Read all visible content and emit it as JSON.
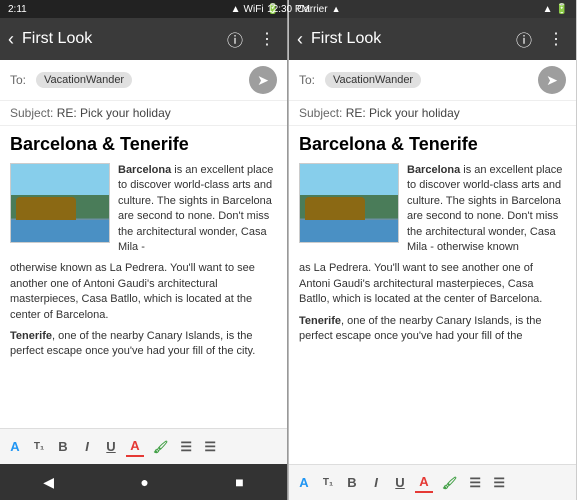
{
  "left_panel": {
    "status_bar": {
      "time": "2:11",
      "icons": "signal wifi battery"
    },
    "app_bar": {
      "title": "First Look",
      "info_icon": "ⓘ",
      "more_icon": "⋮"
    },
    "email": {
      "to_label": "To:",
      "recipient": "VacationWander",
      "subject_label": "Subject:",
      "subject": "RE: Pick your holiday",
      "headline": "Barcelona & Tenerife",
      "body_bold1": "Barcelona",
      "body_text1": " is an excellent place to discover world-class arts and culture. The sights in Barcelona are second to none. Don't miss the architectural wonder, Casa Mila - otherwise known as La Pedrera. You'll want to see another one of Antoni Gaudi's architectural masterpieces, Casa Batllo, which is located at the center of Barcelona.",
      "body_bold2": "Tenerife",
      "body_text2": ", one of the nearby Canary Islands, is the perfect escape once you've had your fill of the city."
    },
    "toolbar": {
      "a_label": "A",
      "t1_label": "T₁",
      "b_label": "B",
      "i_label": "I",
      "u_label": "U",
      "a_color_label": "A",
      "paint_label": "🖌",
      "list1_label": "≡",
      "list2_label": "≡"
    },
    "nav": {
      "back": "◀",
      "home": "●",
      "square": "■"
    }
  },
  "right_panel": {
    "status_bar": {
      "carrier": "Carrier",
      "time": "12:30 PM",
      "icons": "signal battery"
    },
    "app_bar": {
      "title": "First Look",
      "info_icon": "ⓘ",
      "more_icon": "⋮"
    },
    "email": {
      "to_label": "To:",
      "recipient": "VacationWander",
      "subject_label": "Subject:",
      "subject": "RE: Pick your holiday",
      "headline": "Barcelona & Tenerife",
      "body_bold1": "Barcelona",
      "body_text1": " is an excellent place to discover world-class arts and culture. The sights in Barcelona are second to none. Don't miss the architectural wonder, Casa Mila - otherwise known as La Pedrera. You'll want to see another one of Antoni Gaudi's architectural masterpieces, Casa Batllo, which is located at the center of Barcelona.",
      "body_bold2": "Tenerife",
      "body_text2": ", one of the nearby Canary Islands, is the perfect escape once you've had your fill of the"
    },
    "toolbar": {
      "a_label": "A",
      "t1_label": "T₁",
      "b_label": "B",
      "i_label": "I",
      "u_label": "U",
      "a_color_label": "A",
      "paint_label": "🖌",
      "list1_label": "≡",
      "list2_label": "≡"
    }
  }
}
